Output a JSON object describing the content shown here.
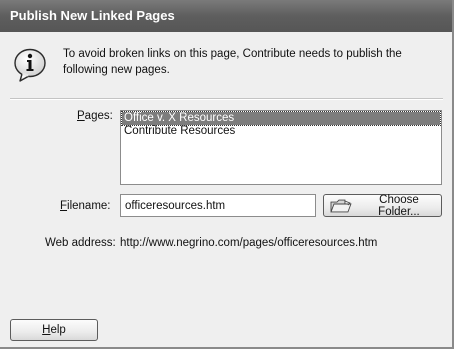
{
  "dialog": {
    "title": "Publish New Linked Pages",
    "message": "To avoid broken links on this page, Contribute needs to publish the\nfollowing new pages."
  },
  "pages": {
    "label": "Pages:",
    "items": [
      "Office v. X Resources",
      "Contribute Resources"
    ],
    "selected_index": 0
  },
  "filename": {
    "label": "Filename:",
    "value": "officeresources.htm"
  },
  "choose_folder": {
    "label": "Choose Folder..."
  },
  "web_address": {
    "label": "Web address:",
    "value": "http://www.negrino.com/pages/officeresources.htm"
  },
  "help": {
    "label": "Help"
  },
  "icons": {
    "info": "info-icon",
    "folder": "folder-icon"
  },
  "colors": {
    "titlebar": "#5e5e5e",
    "selection": "#7d7d7d",
    "dialog_bg": "#efefef"
  }
}
